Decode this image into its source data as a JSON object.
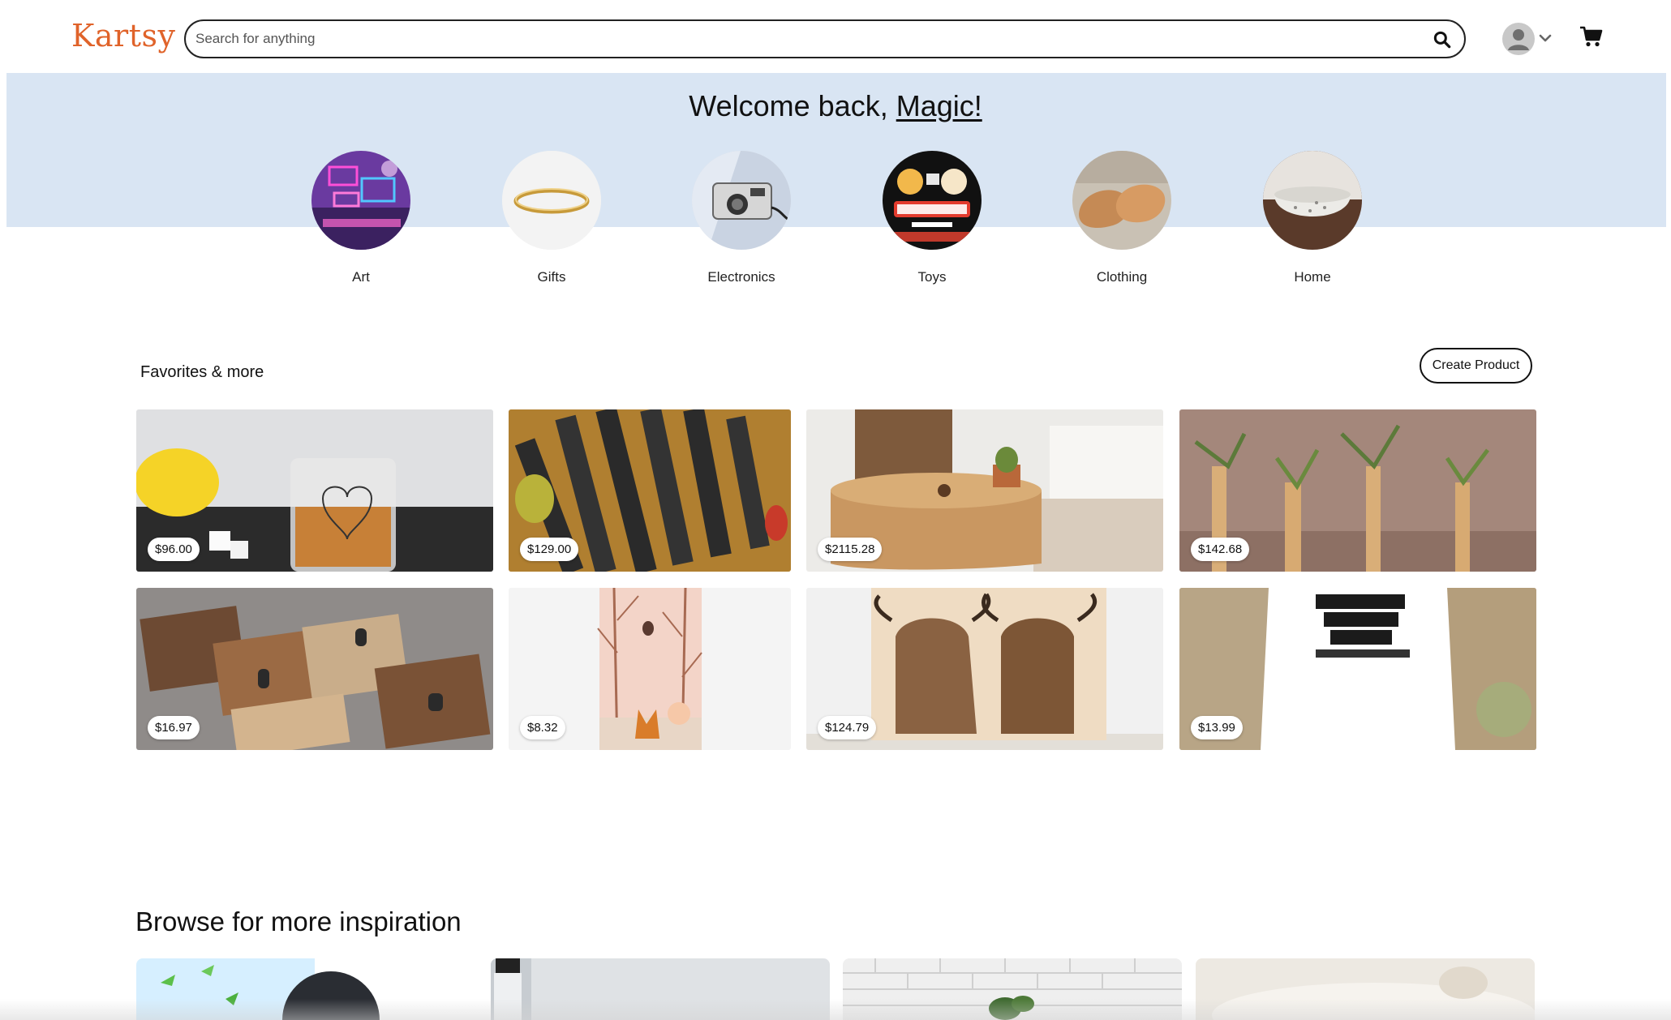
{
  "header": {
    "logo": "Kartsy",
    "search_placeholder": "Search for anything",
    "search_icon": "search-icon",
    "avatar_icon": "user-avatar-icon",
    "dropdown_icon": "chevron-down-icon",
    "cart_icon": "cart-icon"
  },
  "hero": {
    "welcome_prefix": "Welcome back, ",
    "user_name": "Magic!",
    "categories": [
      {
        "label": "Art"
      },
      {
        "label": "Gifts"
      },
      {
        "label": "Electronics"
      },
      {
        "label": "Toys"
      },
      {
        "label": "Clothing"
      },
      {
        "label": "Home"
      }
    ]
  },
  "favorites": {
    "title": "Favorites & more",
    "create_button": "Create Product",
    "products": [
      {
        "price": "$96.00"
      },
      {
        "price": "$129.00"
      },
      {
        "price": "$2115.28"
      },
      {
        "price": "$142.68"
      },
      {
        "price": "$16.97"
      },
      {
        "price": "$8.32"
      },
      {
        "price": "$124.79"
      },
      {
        "price": "$13.99"
      }
    ]
  },
  "browse": {
    "title": "Browse for more inspiration"
  },
  "colors": {
    "brand": "#e0632a",
    "hero_bg": "#d9e5f3",
    "text": "#111111"
  }
}
